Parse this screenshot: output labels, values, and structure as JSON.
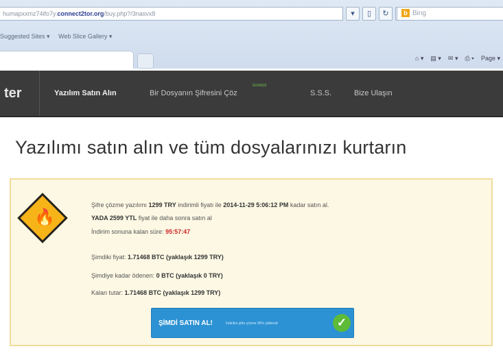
{
  "browser": {
    "address_prefix": "humapxxmz74ifo7y.",
    "address_domain": "connect2tor.org",
    "address_suffix": "/buy.php?/3nasvx8",
    "search_placeholder": "Bing",
    "favorites": [
      "Suggested Sites ▾",
      "Web Slice Gallery ▾"
    ],
    "command_page": "Page ▾"
  },
  "nav": {
    "brand": "ter",
    "items": [
      {
        "label": "Yazılım Satın Alın"
      },
      {
        "label": "Bir Dosyanın Şifresini Çöz"
      },
      {
        "label": "S.S.S."
      },
      {
        "label": "Bize Ulaşın"
      }
    ],
    "badge": "ücretsiz"
  },
  "page": {
    "headline": "Yazılımı satın alın ve tüm dosyalarınızı kurtarın",
    "line1_pre": "Şifre çözme yazılımı ",
    "line1_price": "1299 TRY",
    "line1_mid": " indirimli fiyatı ile ",
    "line1_deadline": "2014-11-29 5:06:12 PM",
    "line1_post": " kadar satın al.",
    "line2_price": "YADA 2599 YTL",
    "line2_post": " fiyat ile daha sonra satın al",
    "line3_label": "İndirim sonuna kalan süre: ",
    "line3_timer": "95:57:47",
    "current_price_label": "Şimdiki fiyat: ",
    "current_price_value": "1.71468 BTC (yaklaşık 1299 TRY)",
    "paid_label": "Şimdiye kadar ödenen: ",
    "paid_value": "0 BTC (yaklaşık 0 TRY)",
    "remaining_label": "Kalan tutar: ",
    "remaining_value": "1.71468 BTC (yaklaşık 1299 TRY)",
    "buy_button": "ŞİMDİ SATIN AL!",
    "buy_button_sub": "İndirilen şifre çözme 95% yüklendi"
  },
  "colors": {
    "nav_bg": "#3b3b3b",
    "panel_bg": "#fcf8e4",
    "panel_border": "#f0dc9a",
    "button_bg": "#2c92d4",
    "timer": "#d02525",
    "check": "#5dbb38"
  }
}
